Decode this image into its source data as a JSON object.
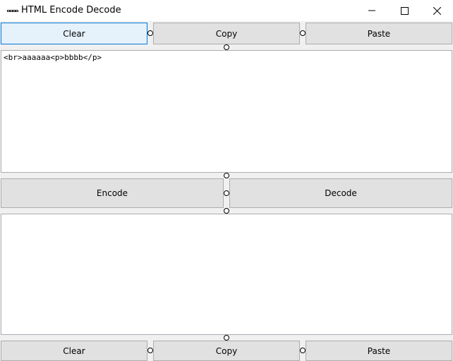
{
  "window": {
    "title": "HTML Encode Decode",
    "icon": "app-logo-icon",
    "controls": [
      "minimize-icon",
      "maximize-icon",
      "close-icon"
    ]
  },
  "top_toolbar": {
    "clear_label": "Clear",
    "copy_label": "Copy",
    "paste_label": "Paste"
  },
  "input": {
    "value": "<br>aaaaaa<p>bbbb</p>"
  },
  "actions": {
    "encode_label": "Encode",
    "decode_label": "Decode"
  },
  "output": {
    "value": ""
  },
  "bottom_toolbar": {
    "clear_label": "Clear",
    "copy_label": "Copy",
    "paste_label": "Paste"
  },
  "colors": {
    "focus_border": "#0078d7",
    "focus_fill": "#e5f1fb",
    "button_fill": "#e1e1e1"
  }
}
